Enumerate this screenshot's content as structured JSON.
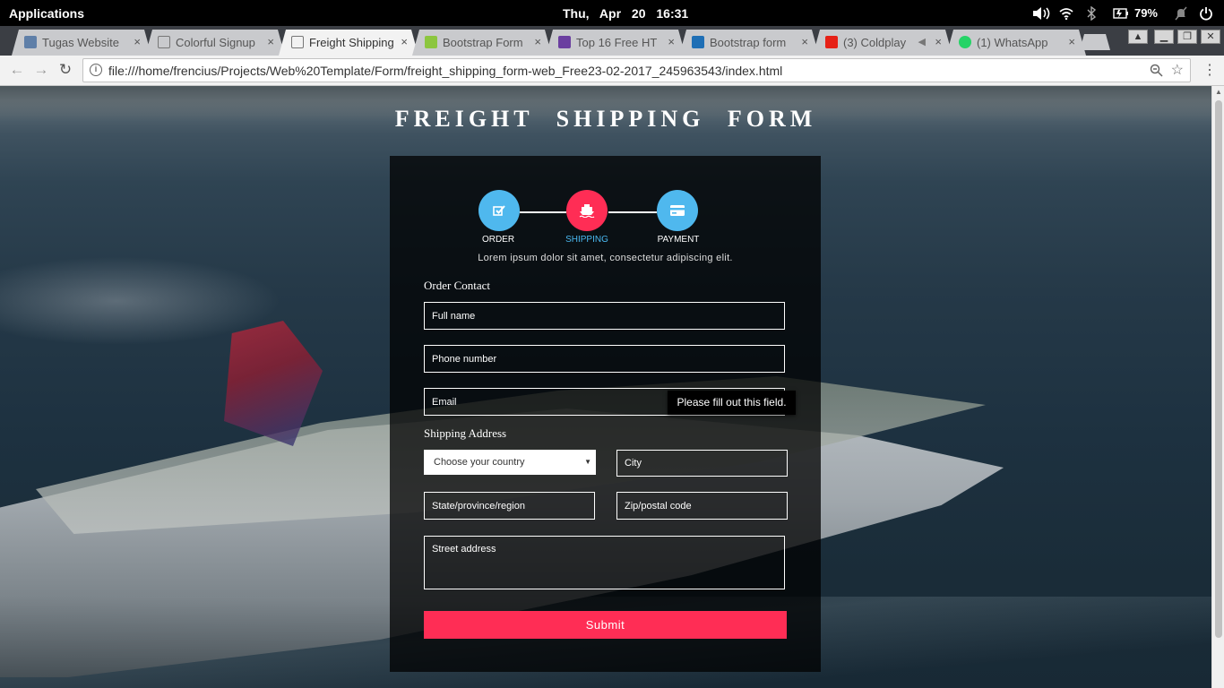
{
  "system": {
    "applications_label": "Applications",
    "clock": "Thu, Apr 20 16:31",
    "battery": "79%"
  },
  "browser": {
    "tabs": [
      {
        "title": "Tugas Website",
        "favicon_color": "#5f7fa8",
        "active": false
      },
      {
        "title": "Colorful Signup",
        "favicon_color": "#888888",
        "active": false
      },
      {
        "title": "Freight Shipping",
        "favicon_color": "#888888",
        "active": true
      },
      {
        "title": "Bootstrap Form",
        "favicon_color": "#8cc63f",
        "active": false
      },
      {
        "title": "Top 16 Free HT",
        "favicon_color": "#6b3fa0",
        "active": false
      },
      {
        "title": "Bootstrap form",
        "favicon_color": "#1f6fb5",
        "active": false
      },
      {
        "title": "(3) Coldplay",
        "favicon_color": "#e62117",
        "active": false
      },
      {
        "title": "(1) WhatsApp",
        "favicon_color": "#25d366",
        "active": false
      }
    ],
    "close_glyph": "×",
    "url": "file:///home/frencius/Projects/Web%20Template/Form/freight_shipping_form-web_Free23-02-2017_245963543/index.html"
  },
  "page": {
    "title": "FREIGHT SHIPPING FORM",
    "steps": [
      {
        "label": "ORDER",
        "icon": "checkbox-icon",
        "color": "#4fb8ee"
      },
      {
        "label": "SHIPPING",
        "icon": "ship-icon",
        "color": "#ff2d55"
      },
      {
        "label": "PAYMENT",
        "icon": "credit-card-icon",
        "color": "#4fb8ee"
      }
    ],
    "current_step": "SHIPPING",
    "intro": "Lorem ipsum dolor sit amet, consectetur adipiscing elit.",
    "order_contact": {
      "heading": "Order Contact",
      "full_name_placeholder": "Full name",
      "phone_placeholder": "Phone number",
      "email_placeholder": "Email"
    },
    "shipping_address": {
      "heading": "Shipping Address",
      "country_selected": "Choose your country",
      "city_placeholder": "City",
      "state_placeholder": "State/province/region",
      "zip_placeholder": "Zip/postal code",
      "street_placeholder": "Street address"
    },
    "submit_label": "Submit",
    "validation_tooltip": "Please fill out this field.",
    "accent_color": "#ff2d55"
  }
}
